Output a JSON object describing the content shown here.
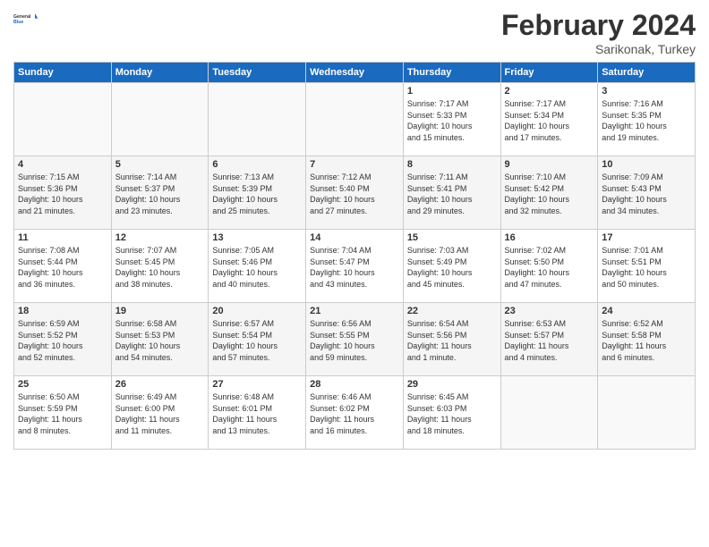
{
  "header": {
    "logo_general": "General",
    "logo_blue": "Blue",
    "title": "February 2024",
    "subtitle": "Sarikonak, Turkey"
  },
  "days_of_week": [
    "Sunday",
    "Monday",
    "Tuesday",
    "Wednesday",
    "Thursday",
    "Friday",
    "Saturday"
  ],
  "weeks": [
    [
      {
        "day": "",
        "text": ""
      },
      {
        "day": "",
        "text": ""
      },
      {
        "day": "",
        "text": ""
      },
      {
        "day": "",
        "text": ""
      },
      {
        "day": "1",
        "text": "Sunrise: 7:17 AM\nSunset: 5:33 PM\nDaylight: 10 hours\nand 15 minutes."
      },
      {
        "day": "2",
        "text": "Sunrise: 7:17 AM\nSunset: 5:34 PM\nDaylight: 10 hours\nand 17 minutes."
      },
      {
        "day": "3",
        "text": "Sunrise: 7:16 AM\nSunset: 5:35 PM\nDaylight: 10 hours\nand 19 minutes."
      }
    ],
    [
      {
        "day": "4",
        "text": "Sunrise: 7:15 AM\nSunset: 5:36 PM\nDaylight: 10 hours\nand 21 minutes."
      },
      {
        "day": "5",
        "text": "Sunrise: 7:14 AM\nSunset: 5:37 PM\nDaylight: 10 hours\nand 23 minutes."
      },
      {
        "day": "6",
        "text": "Sunrise: 7:13 AM\nSunset: 5:39 PM\nDaylight: 10 hours\nand 25 minutes."
      },
      {
        "day": "7",
        "text": "Sunrise: 7:12 AM\nSunset: 5:40 PM\nDaylight: 10 hours\nand 27 minutes."
      },
      {
        "day": "8",
        "text": "Sunrise: 7:11 AM\nSunset: 5:41 PM\nDaylight: 10 hours\nand 29 minutes."
      },
      {
        "day": "9",
        "text": "Sunrise: 7:10 AM\nSunset: 5:42 PM\nDaylight: 10 hours\nand 32 minutes."
      },
      {
        "day": "10",
        "text": "Sunrise: 7:09 AM\nSunset: 5:43 PM\nDaylight: 10 hours\nand 34 minutes."
      }
    ],
    [
      {
        "day": "11",
        "text": "Sunrise: 7:08 AM\nSunset: 5:44 PM\nDaylight: 10 hours\nand 36 minutes."
      },
      {
        "day": "12",
        "text": "Sunrise: 7:07 AM\nSunset: 5:45 PM\nDaylight: 10 hours\nand 38 minutes."
      },
      {
        "day": "13",
        "text": "Sunrise: 7:05 AM\nSunset: 5:46 PM\nDaylight: 10 hours\nand 40 minutes."
      },
      {
        "day": "14",
        "text": "Sunrise: 7:04 AM\nSunset: 5:47 PM\nDaylight: 10 hours\nand 43 minutes."
      },
      {
        "day": "15",
        "text": "Sunrise: 7:03 AM\nSunset: 5:49 PM\nDaylight: 10 hours\nand 45 minutes."
      },
      {
        "day": "16",
        "text": "Sunrise: 7:02 AM\nSunset: 5:50 PM\nDaylight: 10 hours\nand 47 minutes."
      },
      {
        "day": "17",
        "text": "Sunrise: 7:01 AM\nSunset: 5:51 PM\nDaylight: 10 hours\nand 50 minutes."
      }
    ],
    [
      {
        "day": "18",
        "text": "Sunrise: 6:59 AM\nSunset: 5:52 PM\nDaylight: 10 hours\nand 52 minutes."
      },
      {
        "day": "19",
        "text": "Sunrise: 6:58 AM\nSunset: 5:53 PM\nDaylight: 10 hours\nand 54 minutes."
      },
      {
        "day": "20",
        "text": "Sunrise: 6:57 AM\nSunset: 5:54 PM\nDaylight: 10 hours\nand 57 minutes."
      },
      {
        "day": "21",
        "text": "Sunrise: 6:56 AM\nSunset: 5:55 PM\nDaylight: 10 hours\nand 59 minutes."
      },
      {
        "day": "22",
        "text": "Sunrise: 6:54 AM\nSunset: 5:56 PM\nDaylight: 11 hours\nand 1 minute."
      },
      {
        "day": "23",
        "text": "Sunrise: 6:53 AM\nSunset: 5:57 PM\nDaylight: 11 hours\nand 4 minutes."
      },
      {
        "day": "24",
        "text": "Sunrise: 6:52 AM\nSunset: 5:58 PM\nDaylight: 11 hours\nand 6 minutes."
      }
    ],
    [
      {
        "day": "25",
        "text": "Sunrise: 6:50 AM\nSunset: 5:59 PM\nDaylight: 11 hours\nand 8 minutes."
      },
      {
        "day": "26",
        "text": "Sunrise: 6:49 AM\nSunset: 6:00 PM\nDaylight: 11 hours\nand 11 minutes."
      },
      {
        "day": "27",
        "text": "Sunrise: 6:48 AM\nSunset: 6:01 PM\nDaylight: 11 hours\nand 13 minutes."
      },
      {
        "day": "28",
        "text": "Sunrise: 6:46 AM\nSunset: 6:02 PM\nDaylight: 11 hours\nand 16 minutes."
      },
      {
        "day": "29",
        "text": "Sunrise: 6:45 AM\nSunset: 6:03 PM\nDaylight: 11 hours\nand 18 minutes."
      },
      {
        "day": "",
        "text": ""
      },
      {
        "day": "",
        "text": ""
      }
    ]
  ]
}
